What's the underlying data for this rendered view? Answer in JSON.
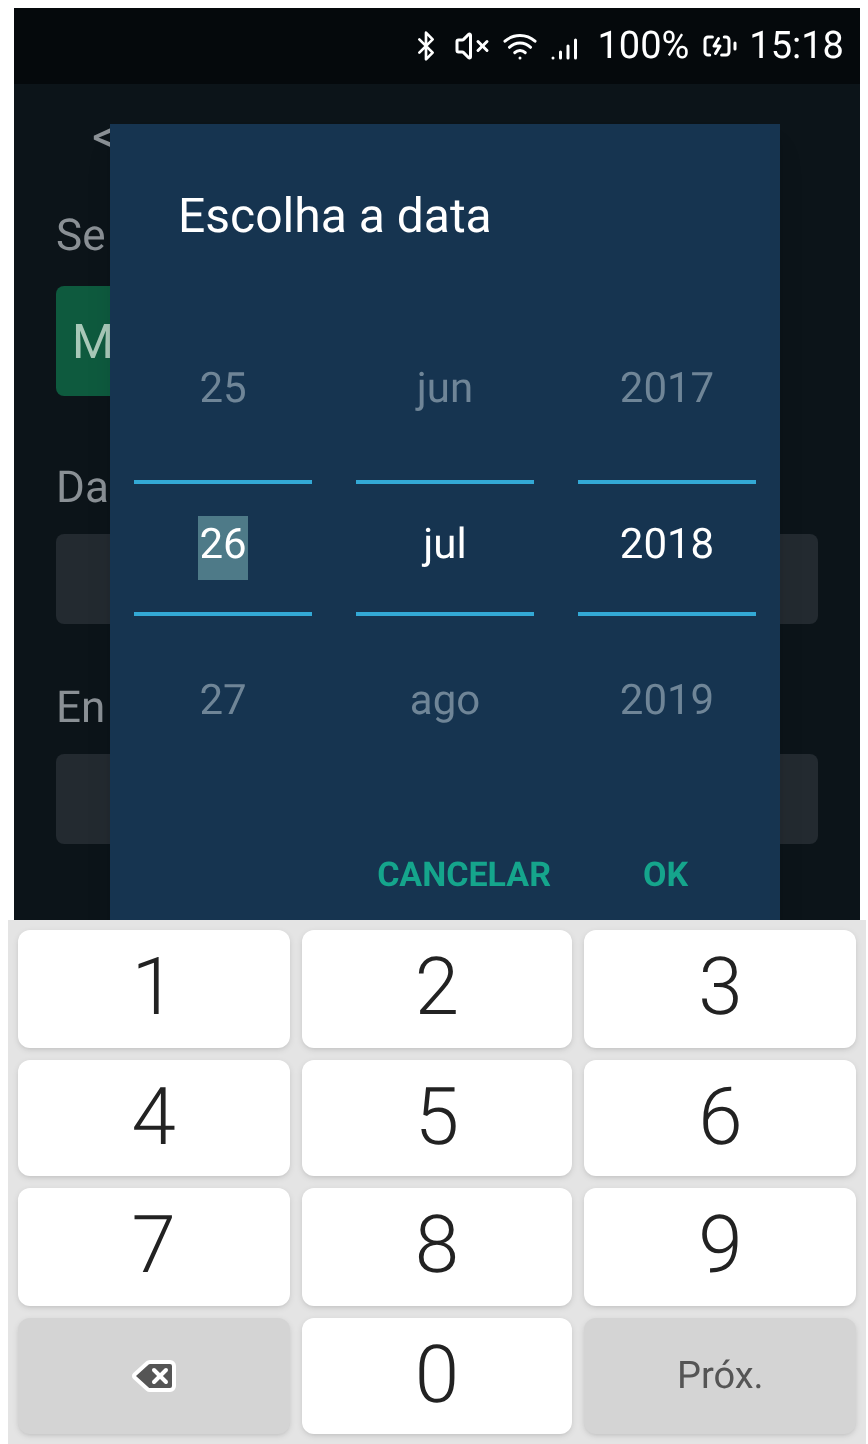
{
  "status_bar": {
    "battery": "100%",
    "time": "15:18"
  },
  "background": {
    "back": "<",
    "labels": [
      "Se",
      "Da",
      "En"
    ],
    "button": "M"
  },
  "dialog": {
    "title": "Escolha a data",
    "columns": [
      {
        "items": [
          {
            "label": "25",
            "selected": false
          },
          {
            "label": "26",
            "selected": true,
            "text_highlighted": true
          },
          {
            "label": "27",
            "selected": false
          }
        ]
      },
      {
        "items": [
          {
            "label": "jun",
            "selected": false
          },
          {
            "label": "jul",
            "selected": true,
            "text_highlighted": false
          },
          {
            "label": "ago",
            "selected": false
          }
        ]
      },
      {
        "items": [
          {
            "label": "2017",
            "selected": false
          },
          {
            "label": "2018",
            "selected": true,
            "text_highlighted": false
          },
          {
            "label": "2019",
            "selected": false
          }
        ]
      }
    ],
    "buttons": [
      "CANCELAR",
      "OK"
    ]
  },
  "keyboard": {
    "keys": [
      {
        "kind": "digit",
        "label": "1"
      },
      {
        "kind": "digit",
        "label": "2"
      },
      {
        "kind": "digit",
        "label": "3"
      },
      {
        "kind": "digit",
        "label": "4"
      },
      {
        "kind": "digit",
        "label": "5"
      },
      {
        "kind": "digit",
        "label": "6"
      },
      {
        "kind": "digit",
        "label": "7"
      },
      {
        "kind": "digit",
        "label": "8"
      },
      {
        "kind": "digit",
        "label": "9"
      },
      {
        "kind": "backspace"
      },
      {
        "kind": "digit",
        "label": "0"
      },
      {
        "kind": "action",
        "label": "Próx."
      }
    ]
  }
}
